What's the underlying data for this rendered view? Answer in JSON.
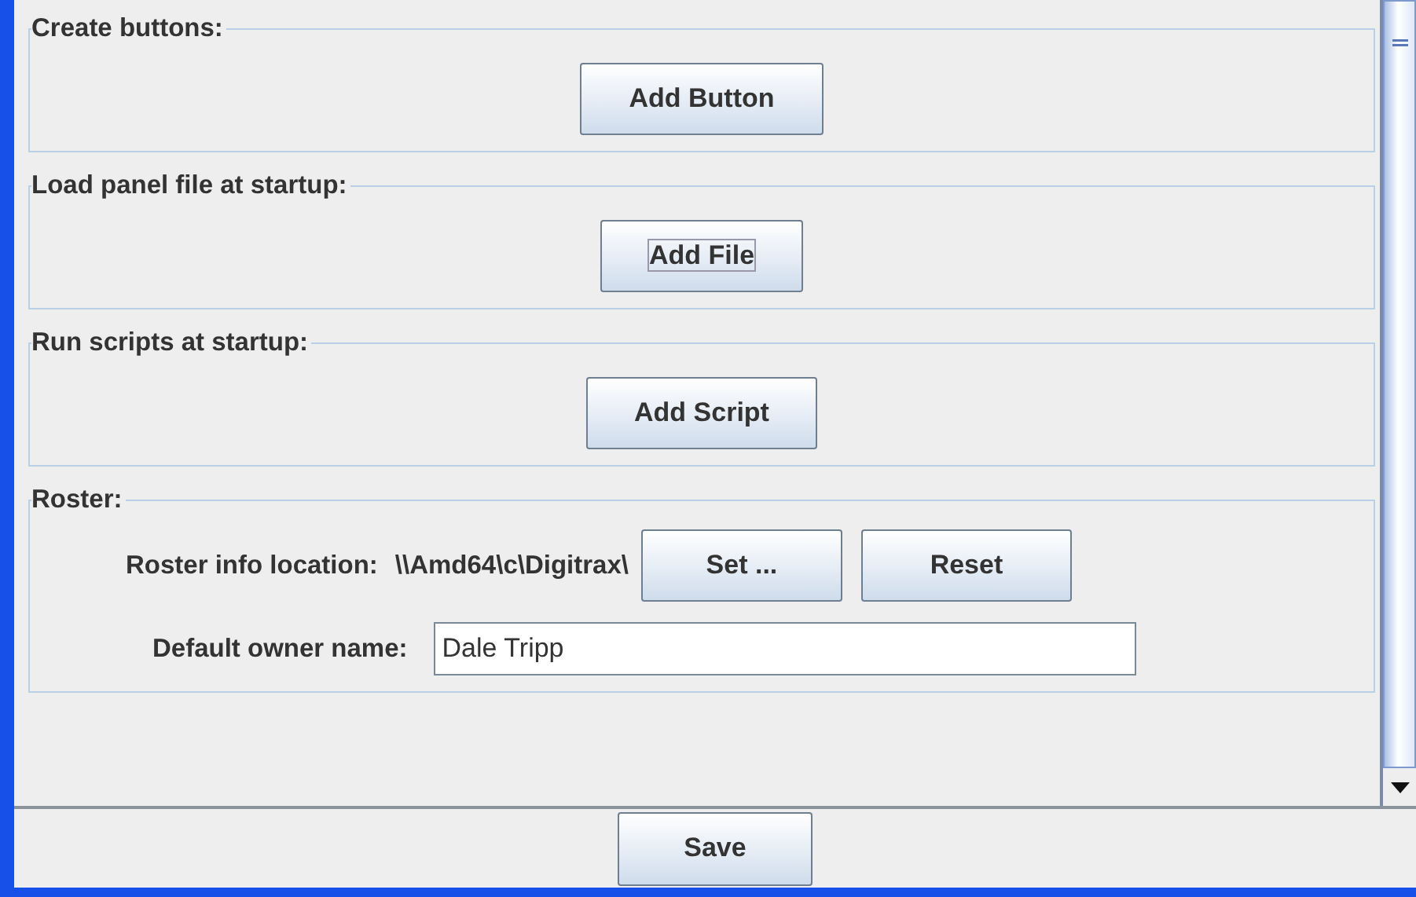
{
  "groups": [
    {
      "title": "Create buttons:",
      "kind": "button",
      "button": "Add Button",
      "focused": false
    },
    {
      "title": "Load panel file at startup:",
      "kind": "button",
      "button": "Add File",
      "focused": true
    },
    {
      "title": "Run scripts at startup:",
      "kind": "button",
      "button": "Add Script",
      "focused": false
    },
    {
      "title": "Roster:",
      "kind": "roster",
      "location_label": "Roster info location:",
      "location": "\\\\Amd64\\c\\Digitrax\\",
      "buttons": [
        "Set ...",
        "Reset"
      ],
      "owner_label": "Default owner name:",
      "owner": "Dale Tripp"
    }
  ],
  "save": "Save"
}
